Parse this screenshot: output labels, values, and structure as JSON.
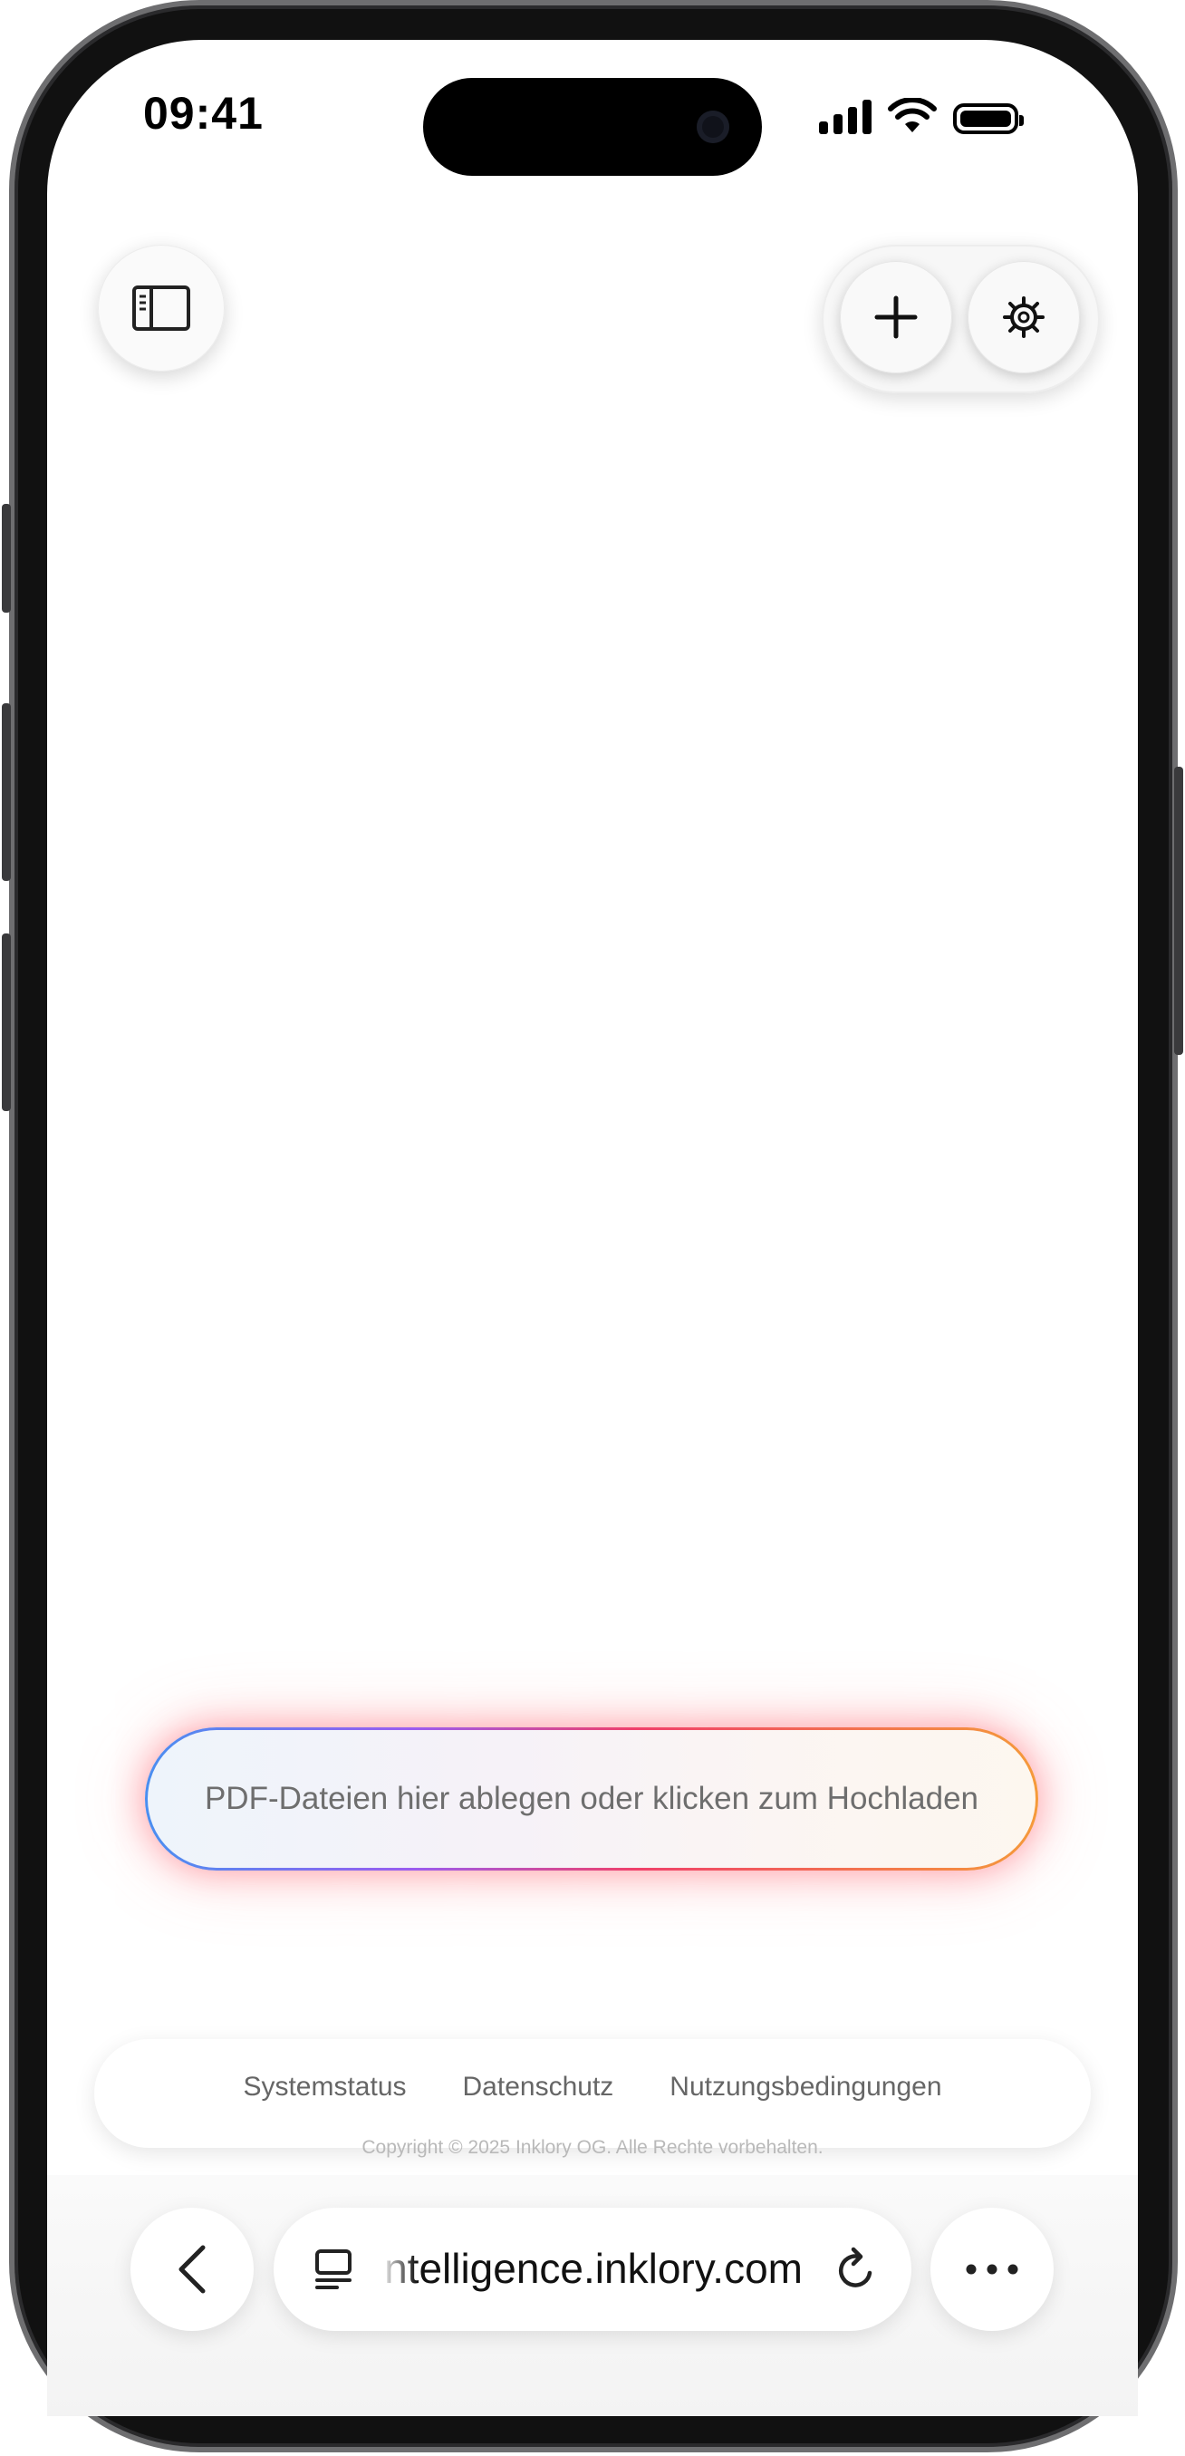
{
  "status_bar": {
    "time": "09:41"
  },
  "top_bar": {
    "sidebar_icon": "sidebar-icon",
    "add_icon": "plus-icon",
    "settings_icon": "gear-icon"
  },
  "upload": {
    "prompt": "PDF-Dateien hier ablegen oder klicken zum Hochladen"
  },
  "footer": {
    "links": [
      "Systemstatus",
      "Datenschutz",
      "Nutzungsbedingungen"
    ],
    "copyright": "Copyright © 2025 Inklory OG. Alle Rechte vorbehalten."
  },
  "browser": {
    "url": "intelligence.inklory.com",
    "back_icon": "chevron-left-icon",
    "tabs_icon": "tab-overview-icon",
    "reload_icon": "reload-icon",
    "more_icon": "more-icon"
  },
  "colors": {
    "dropzone_gradient": [
      "#4a8ff0",
      "#9a5cf0",
      "#f0406a",
      "#f59a3a"
    ],
    "glow": "#ff3c50"
  }
}
